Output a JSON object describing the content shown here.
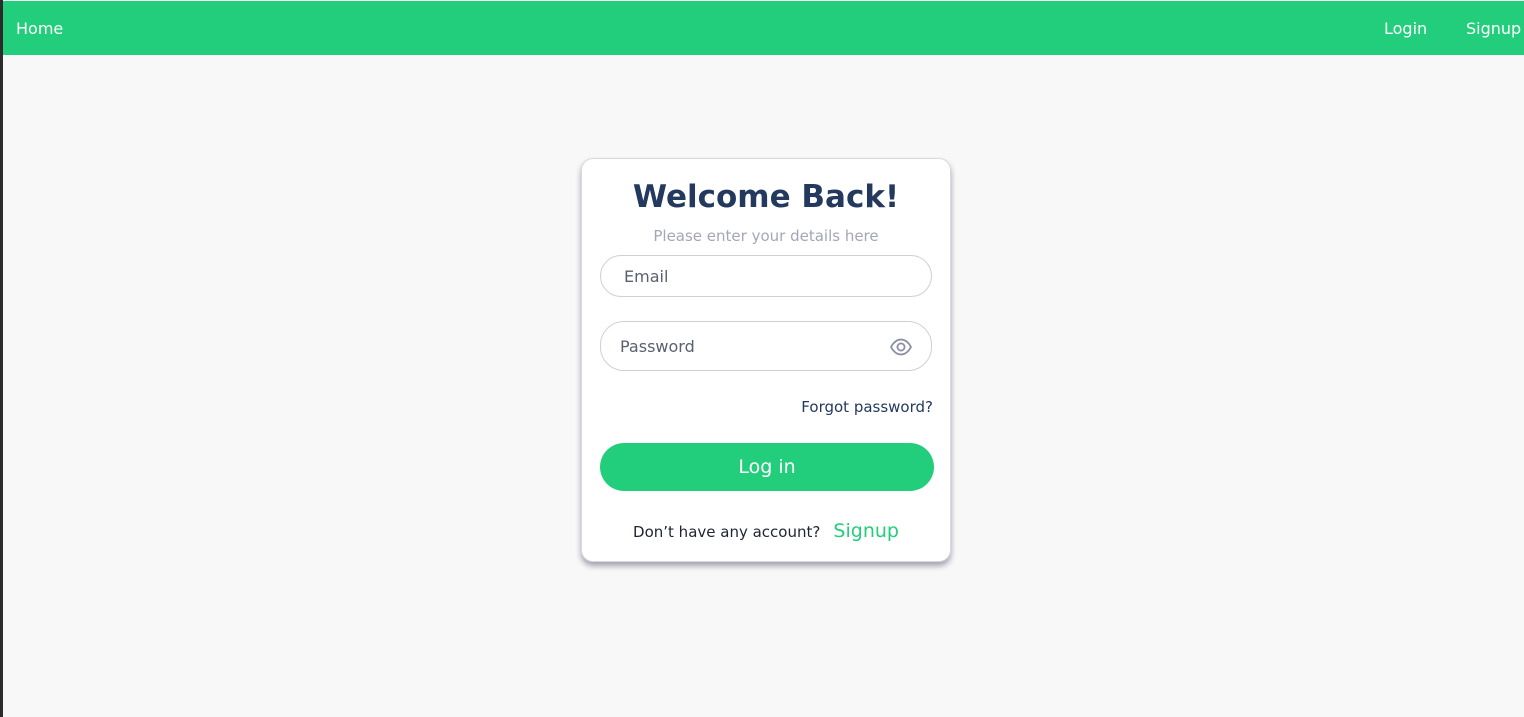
{
  "nav": {
    "home_label": "Home",
    "login_label": "Login",
    "signup_label": "Signup",
    "background_color": "#22ce7b"
  },
  "login_card": {
    "title": "Welcome Back!",
    "subtitle": "Please enter your details here",
    "email_placeholder": "Email",
    "password_placeholder": "Password",
    "password_toggle_icon": "eye-icon",
    "forgot_password_label": "Forgot password?",
    "submit_label": "Log in",
    "no_account_text": "Don’t have any account?",
    "signup_link_label": "Signup",
    "accent_color": "#22ce7b",
    "title_color": "#233a5e"
  }
}
